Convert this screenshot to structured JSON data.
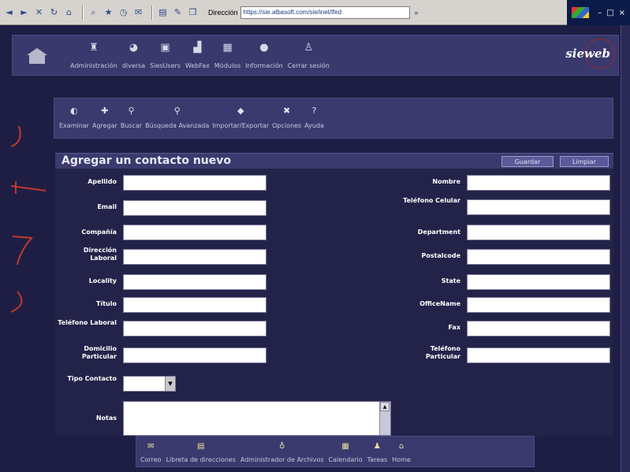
{
  "browser": {
    "address_label": "Dirección",
    "url": "https://sie.albasoft.com/sie/inet/lfed",
    "go_label": "»"
  },
  "app": {
    "brand": "sieweb",
    "top_nav": [
      {
        "label": "Administración",
        "icon": "admin-icon"
      },
      {
        "label": "diversa",
        "icon": "globe-icon"
      },
      {
        "label": "SiesUsers",
        "icon": "users-icon"
      },
      {
        "label": "WebFax",
        "icon": "fax-icon"
      },
      {
        "label": "Módulos",
        "icon": "modules-icon"
      },
      {
        "label": "Información",
        "icon": "info-icon"
      },
      {
        "label": "Cerrar sesión",
        "icon": "logout-icon"
      }
    ]
  },
  "sub_nav": [
    {
      "label": "Examinar",
      "icon": "browse-icon"
    },
    {
      "label": "Agregar",
      "icon": "add-icon"
    },
    {
      "label": "Buscar",
      "icon": "search-icon"
    },
    {
      "label": "Búsqueda Avanzada",
      "icon": "advanced-search-icon"
    },
    {
      "label": "Importar/Exportar",
      "icon": "import-export-icon"
    },
    {
      "label": "Opciones",
      "icon": "options-icon"
    },
    {
      "label": "Ayuda",
      "icon": "help-icon"
    }
  ],
  "form": {
    "title": "Agregar un contacto nuevo",
    "save_label": "Guardar",
    "clear_label": "Limpiar",
    "left_fields": [
      {
        "label": "Apellido",
        "value": ""
      },
      {
        "label": "Email",
        "value": ""
      },
      {
        "label": "Compañía",
        "value": ""
      },
      {
        "label": "Dirección Laboral",
        "value": ""
      },
      {
        "label": "Locality",
        "value": ""
      },
      {
        "label": "Título",
        "value": ""
      },
      {
        "label": "Teléfono Laboral",
        "value": ""
      },
      {
        "label": "Domicilio Particular",
        "value": ""
      }
    ],
    "right_fields": [
      {
        "label": "Nombre",
        "value": ""
      },
      {
        "label": "Teléfono Celular",
        "value": ""
      },
      {
        "label": "Department",
        "value": ""
      },
      {
        "label": "Postalcode",
        "value": ""
      },
      {
        "label": "State",
        "value": ""
      },
      {
        "label": "OfficeName",
        "value": ""
      },
      {
        "label": "Fax",
        "value": ""
      },
      {
        "label": "Teléfono Particular",
        "value": ""
      }
    ],
    "type_label": "Tipo Contacto",
    "type_value": "",
    "notes_label": "Notas",
    "notes_value": ""
  },
  "bottom_nav": [
    {
      "label": "Correo",
      "icon": "mail-icon"
    },
    {
      "label": "Libreta de direcciones",
      "icon": "address-book-icon"
    },
    {
      "label": "Administrador de Archivos",
      "icon": "file-manager-icon"
    },
    {
      "label": "Calendario",
      "icon": "calendar-icon"
    },
    {
      "label": "Tareas",
      "icon": "tasks-icon"
    },
    {
      "label": "Home",
      "icon": "home-icon"
    }
  ]
}
